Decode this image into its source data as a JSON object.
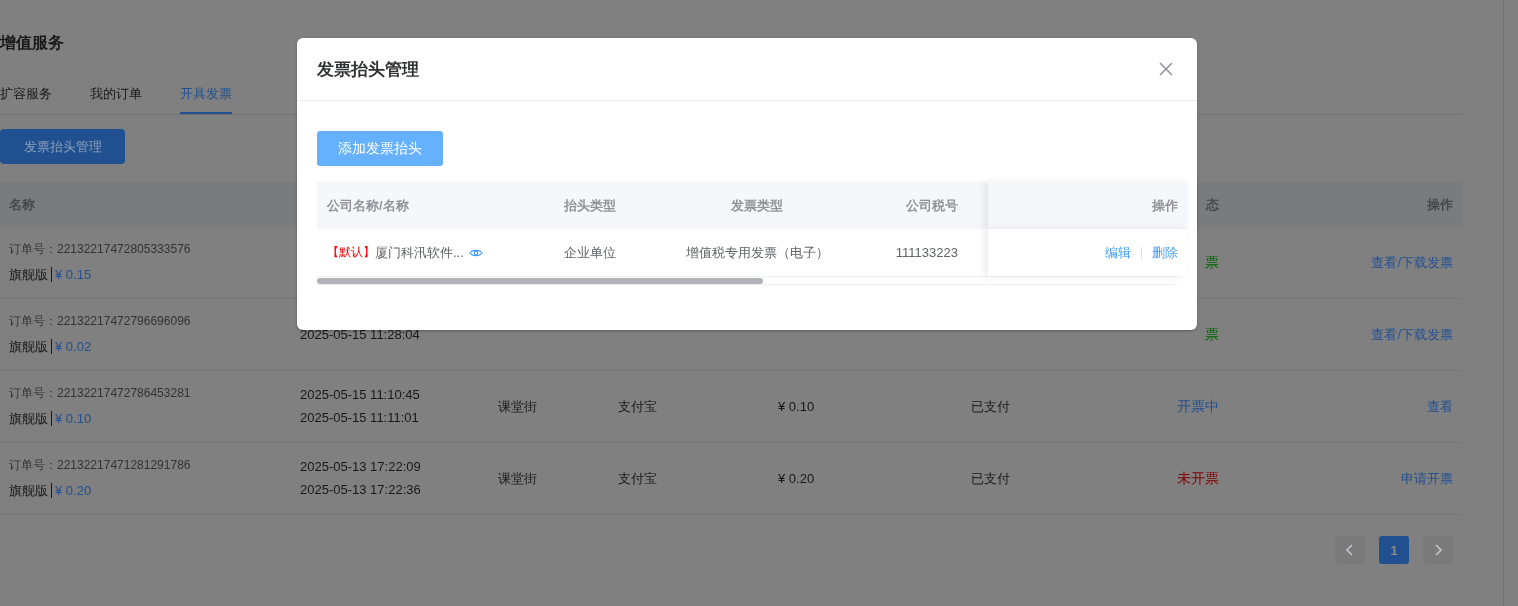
{
  "page": {
    "title": "增值服务",
    "tabs": [
      {
        "label": "扩容服务",
        "selected": false
      },
      {
        "label": "我的订单",
        "selected": false
      },
      {
        "label": "开具发票",
        "selected": true
      }
    ],
    "header_button": "发票抬头管理",
    "table": {
      "columns": [
        "名称",
        "态",
        "操作"
      ],
      "rows": [
        {
          "order_no": "订单号：22132217472805333576",
          "plan": "旗舰版",
          "price": "¥ 0.15",
          "status": {
            "text": "票",
            "color": "#006400"
          },
          "action": "查看/下载发票"
        },
        {
          "order_no": "订单号：22132217472796696096",
          "plan": "旗舰版",
          "price": "¥ 0.02",
          "times": [
            "2025-05-15 11:28:04"
          ],
          "status": {
            "text": "票",
            "color": "#006400"
          },
          "action": "查看/下载发票"
        },
        {
          "order_no": "订单号：22132217472786453281",
          "plan": "旗舰版",
          "price": "¥ 0.10",
          "times": [
            "2025-05-15 11:10:45",
            "2025-05-15 11:11:01"
          ],
          "platform": "课堂街",
          "payment": "支付宝",
          "amount": "¥ 0.10",
          "pay_status": "已支付",
          "status": {
            "text": "开票中",
            "color": "#205090"
          },
          "action": "查看"
        },
        {
          "order_no": "订单号：22132217471281291786",
          "plan": "旗舰版",
          "price": "¥ 0.20",
          "times": [
            "2025-05-13 17:22:09",
            "2025-05-13 17:22:36"
          ],
          "platform": "课堂街",
          "payment": "支付宝",
          "amount": "¥ 0.20",
          "pay_status": "已支付",
          "status": {
            "text": "未开票",
            "color": "#800000"
          },
          "action": "申请开票"
        }
      ]
    },
    "pagination": {
      "pages": [
        {
          "label": "1",
          "selected": true
        }
      ]
    }
  },
  "dialog": {
    "title": "发票抬头管理",
    "add_button": "添加发票抬头",
    "columns": [
      "公司名称/名称",
      "抬头类型",
      "发票类型",
      "公司税号",
      "操作"
    ],
    "rows": [
      {
        "default_tag": "【默认】",
        "name": "厦门科汛软件...",
        "title_type": "企业单位",
        "invoice_type": "增值税专用发票（电子）",
        "tax_no": "111133223",
        "actions": [
          "编辑",
          "删除"
        ]
      }
    ]
  }
}
